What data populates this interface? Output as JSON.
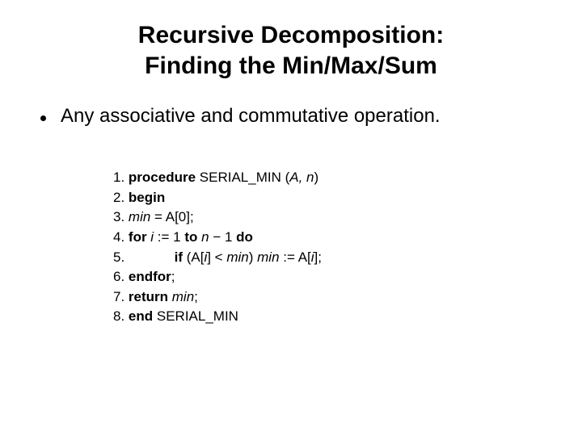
{
  "title_line1": "Recursive Decomposition:",
  "title_line2": "Finding the Min/Max/Sum",
  "bullet_text": "Any associative and commutative operation.",
  "code": {
    "l1_num": "1. ",
    "l1_kw": "procedure ",
    "l1_name": "SERIAL_MIN (",
    "l1_args": "A, n",
    "l1_close": ")",
    "l2_num": "2. ",
    "l2_kw": "begin",
    "l3_num": "3. ",
    "l3_var": "min",
    "l3_rest": " = A[0];",
    "l4_num": "4. ",
    "l4_kw1": "for ",
    "l4_var": "i",
    "l4_mid": " := 1 ",
    "l4_kw2": "to ",
    "l4_expr": "n",
    "l4_rest": " − 1 ",
    "l4_kw3": "do",
    "l5_num": "5.             ",
    "l5_kw": "if ",
    "l5_cond_open": "(A[",
    "l5_i1": "i",
    "l5_cond_mid": "] < ",
    "l5_min1": "min",
    "l5_cond_close": ") ",
    "l5_min2": "min",
    "l5_assign": " := A[",
    "l5_i2": "i",
    "l5_end": "];",
    "l6_num": "6. ",
    "l6_kw": "endfor",
    "l6_semi": ";",
    "l7_num": "7. ",
    "l7_kw": "return ",
    "l7_var": "min",
    "l7_semi": ";",
    "l8_num": "8. ",
    "l8_kw": "end ",
    "l8_name": "SERIAL_MIN"
  }
}
